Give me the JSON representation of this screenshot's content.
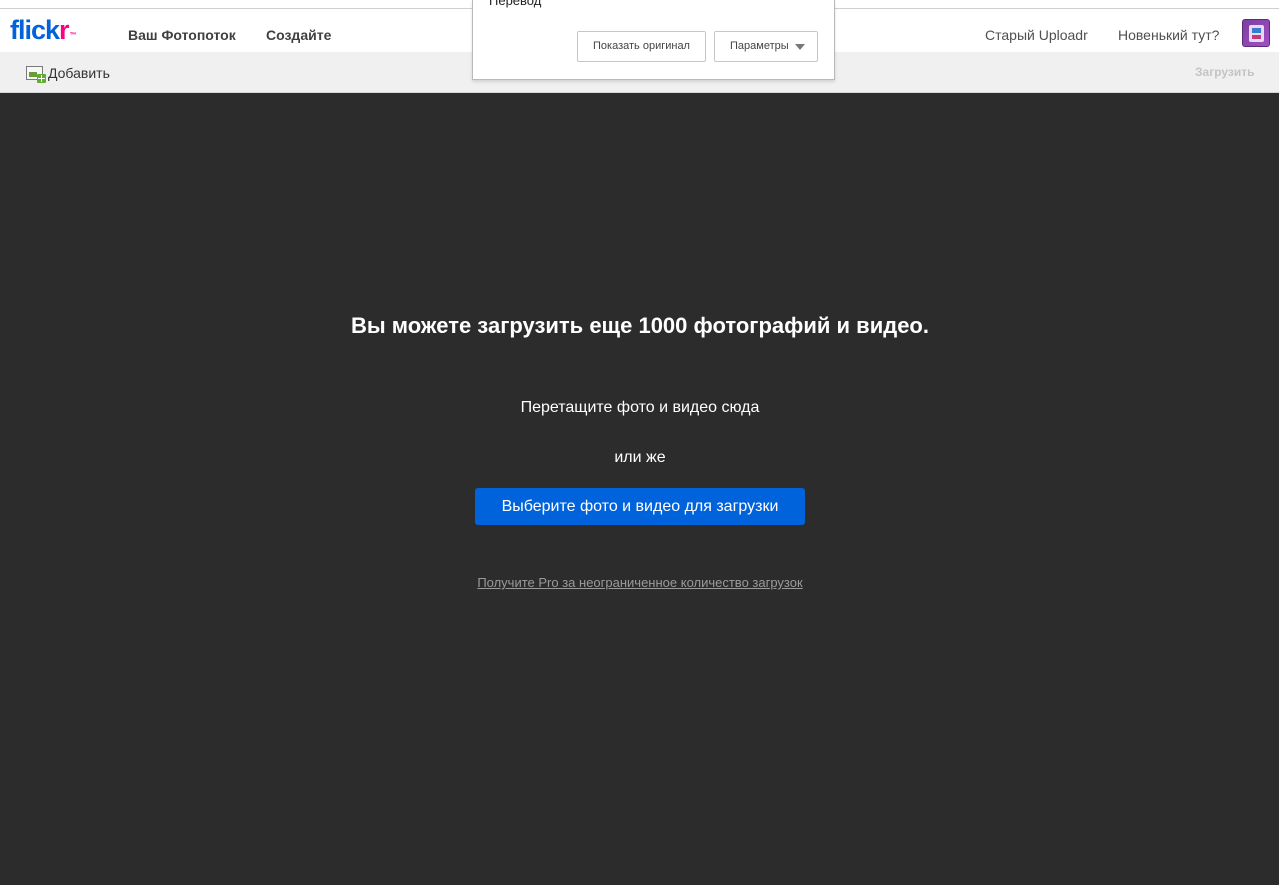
{
  "header": {
    "logo_main": "flick",
    "logo_r": "r",
    "logo_tm": "™",
    "nav": {
      "photostream": "Ваш Фотопоток",
      "create": "Создайте"
    },
    "right": {
      "old_uploadr": "Старый Uploadr",
      "whats_new": "Новенький тут?"
    }
  },
  "toolbar": {
    "add_label": "Добавить",
    "upload_label": "Загрузить"
  },
  "translate_popup": {
    "title": "Перевод",
    "show_original": "Показать оригинал",
    "params": "Параметры"
  },
  "main": {
    "headline": "Вы можете загрузить еще 1000 фотографий и видео.",
    "drag_text": "Перетащите фото и видео сюда",
    "or_text": "или же",
    "choose_button": "Выберите фото и видео для загрузки",
    "pro_link": "Получите Pro за неограниченное количество загрузок"
  },
  "colors": {
    "brand_blue": "#0063dc",
    "brand_pink": "#ff0084",
    "background_dark": "#2c2c2c"
  }
}
